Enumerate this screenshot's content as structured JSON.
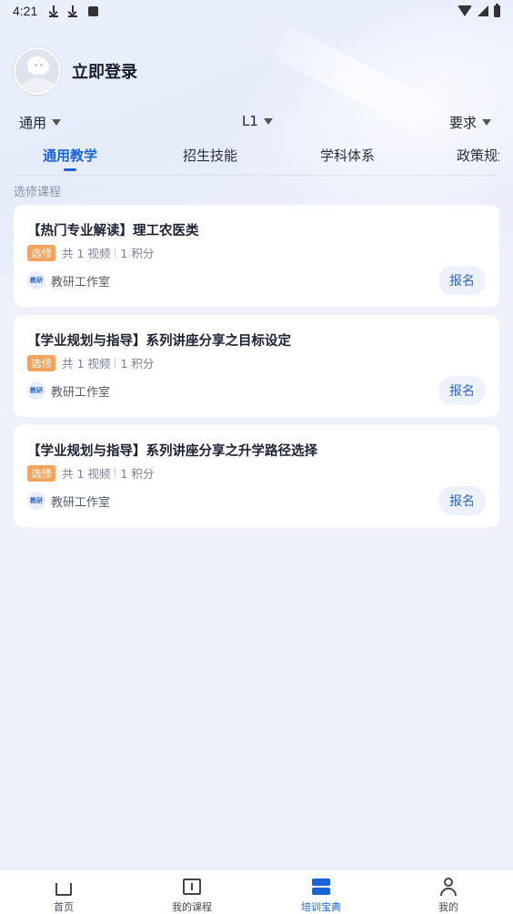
{
  "status_bar": {
    "time": "4:21"
  },
  "header": {
    "login_label": "立即登录"
  },
  "filters": [
    {
      "label": "通用"
    },
    {
      "label": "L1"
    },
    {
      "label": "要求"
    }
  ],
  "tabs": [
    {
      "label": "通用教学",
      "active": true
    },
    {
      "label": "招生技能",
      "active": false
    },
    {
      "label": "学科体系",
      "active": false
    },
    {
      "label": "政策规划",
      "active": false
    }
  ],
  "section_label": "选修课程",
  "courses": [
    {
      "title": "【热门专业解读】理工农医类",
      "tag": "选修",
      "videos": "共 1 视频",
      "points": "1 积分",
      "org_badge": "教研",
      "org": "教研工作室",
      "action": "报名"
    },
    {
      "title": "【学业规划与指导】系列讲座分享之目标设定",
      "tag": "选修",
      "videos": "共 1 视频",
      "points": "1 积分",
      "org_badge": "教研",
      "org": "教研工作室",
      "action": "报名"
    },
    {
      "title": "【学业规划与指导】系列讲座分享之升学路径选择",
      "tag": "选修",
      "videos": "共 1 视频",
      "points": "1 积分",
      "org_badge": "教研",
      "org": "教研工作室",
      "action": "报名"
    }
  ],
  "bottom_nav": [
    {
      "label": "首页",
      "icon": "home-icon",
      "active": false
    },
    {
      "label": "我的课程",
      "icon": "book-icon",
      "active": false
    },
    {
      "label": "培训宝典",
      "icon": "training-icon",
      "active": true
    },
    {
      "label": "我的",
      "icon": "profile-icon",
      "active": false
    }
  ],
  "colors": {
    "accent": "#1a62d8",
    "tag": "#f3a35c",
    "background": "#eef0fa"
  }
}
